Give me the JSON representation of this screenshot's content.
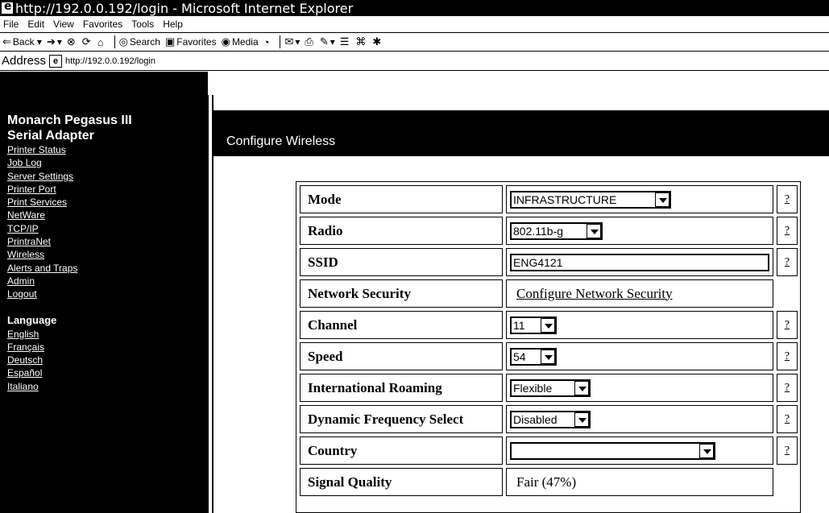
{
  "window": {
    "title": "http://192.0.0.192/login - Microsoft Internet Explorer"
  },
  "menu": [
    "File",
    "Edit",
    "View",
    "Favorites",
    "Tools",
    "Help"
  ],
  "toolbar": {
    "back": "Back",
    "search": "Search",
    "favorites": "Favorites",
    "media": "Media"
  },
  "address": {
    "label": "Address",
    "url": "http://192.0.0.192/login"
  },
  "sidebar": {
    "title_line1": "Monarch Pegasus III",
    "title_line2": "Serial Adapter",
    "links": [
      "Printer Status",
      "Job Log",
      "Server Settings",
      "Printer Port",
      "Print Services",
      "NetWare",
      "TCP/IP",
      "PrintraNet",
      "Wireless",
      "Alerts and Traps",
      "Admin",
      "Logout"
    ],
    "language_heading": "Language",
    "languages": [
      "English",
      "Français",
      "Deutsch",
      "Español",
      "Italiano"
    ]
  },
  "page": {
    "heading": "Configure Wireless"
  },
  "form": {
    "help_label": "?",
    "rows": [
      {
        "label": "Mode",
        "type": "select",
        "value": "INFRASTRUCTURE"
      },
      {
        "label": "Radio",
        "type": "select",
        "value": "802.11b-g"
      },
      {
        "label": "SSID",
        "type": "text",
        "value": "ENG4121"
      },
      {
        "label": "Network Security",
        "type": "link",
        "value": "Configure Network Security"
      },
      {
        "label": "Channel",
        "type": "select",
        "value": "11"
      },
      {
        "label": "Speed",
        "type": "select",
        "value": "54"
      },
      {
        "label": "International Roaming",
        "type": "select",
        "value": "Flexible"
      },
      {
        "label": "Dynamic Frequency Select",
        "type": "select",
        "value": "Disabled"
      },
      {
        "label": "Country",
        "type": "select",
        "value": ""
      },
      {
        "label": "Signal Quality",
        "type": "static",
        "value": "Fair (47%)"
      }
    ]
  }
}
